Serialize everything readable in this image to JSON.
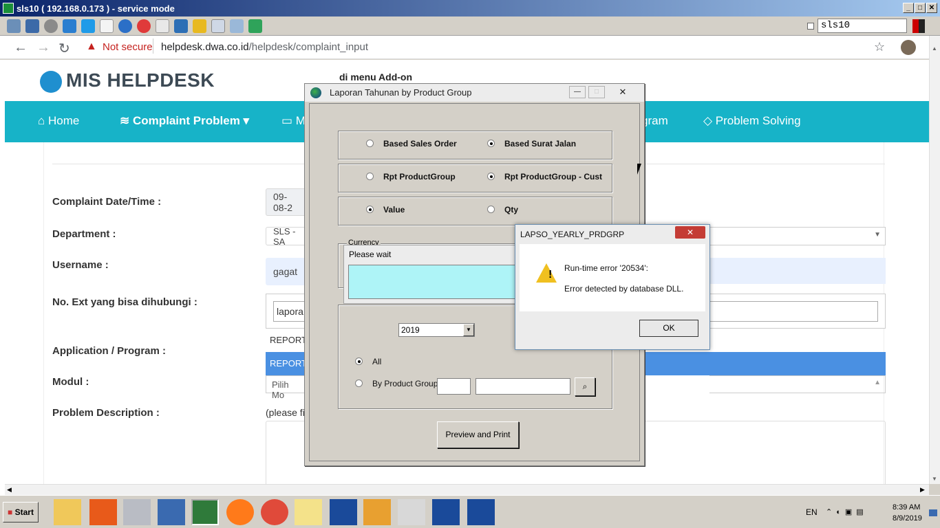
{
  "remote": {
    "title": "sls10 ( 192.168.0.173 ) - service mode",
    "host_field": "sls10",
    "toolbar_icons": [
      "network-icon",
      "fullscreen-icon",
      "gear-icon",
      "refresh-icon",
      "windows-icon",
      "document-icon",
      "info-icon",
      "stop-icon",
      "transfer-icon",
      "monitor-icon",
      "folder-icon",
      "screen-icon",
      "display-icon",
      "chat-icon"
    ]
  },
  "browser": {
    "not_secure": "Not secure",
    "url_host": "helpdesk.dwa.co.id",
    "url_path": "/helpdesk/complaint_input"
  },
  "site": {
    "logo": "MIS HELPDESK",
    "note": "di menu Add-on",
    "nav": {
      "home": "Home",
      "complaint": "Complaint Problem",
      "m_partial": "M",
      "gram_partial": "gram",
      "solving": "Problem Solving"
    },
    "form": {
      "date_label": "Complaint Date/Time :",
      "date_value": "09-08-2",
      "dept_label": "Department :",
      "dept_value": "SLS - SA",
      "user_label": "Username :",
      "user_value": "gagat",
      "ext_label": "No. Ext yang bisa dihubungi :",
      "search_value": "lapora",
      "opt1": "REPORT",
      "opt2": "REPORT",
      "app_label": "Application / Program :",
      "modul_label": "Modul :",
      "modul_value": "Pilih Mo",
      "desc_label": "Problem Description :",
      "desc_hint": "(please fi"
    }
  },
  "dialog": {
    "title": "Laporan Tahunan by Product Group",
    "r1": "Based Sales Order",
    "r2": "Based Surat Jalan",
    "r3": "Rpt ProductGroup",
    "r4": "Rpt ProductGroup - Cust",
    "r5": "Value",
    "r6": "Qty",
    "currency": "Currency",
    "year": "2019",
    "all": "All",
    "by_group": "By Product Group",
    "preview": "Preview and Print"
  },
  "wait": {
    "title": "Please wait"
  },
  "error": {
    "title": "LAPSO_YEARLY_PRDGRP",
    "line1": "Run-time error '20534':",
    "line2": "Error detected by database DLL.",
    "ok": "OK"
  },
  "taskbar": {
    "start": "Start",
    "lang": "EN",
    "time": "8:39 AM",
    "date": "8/9/2019",
    "apps": [
      "explorer-icon",
      "pdf-icon",
      "scissors-icon",
      "computer-icon",
      "eye-icon",
      "firefox-icon",
      "chrome-icon",
      "sticky-notes-icon",
      "globe-icon",
      "outlook-icon",
      "calendar-icon",
      "globe-icon",
      "globe-icon"
    ]
  },
  "colors": {
    "nav_bg": "#17b3c8",
    "selected_row": "#4a90e2",
    "wait_bar": "#aef4f7"
  }
}
